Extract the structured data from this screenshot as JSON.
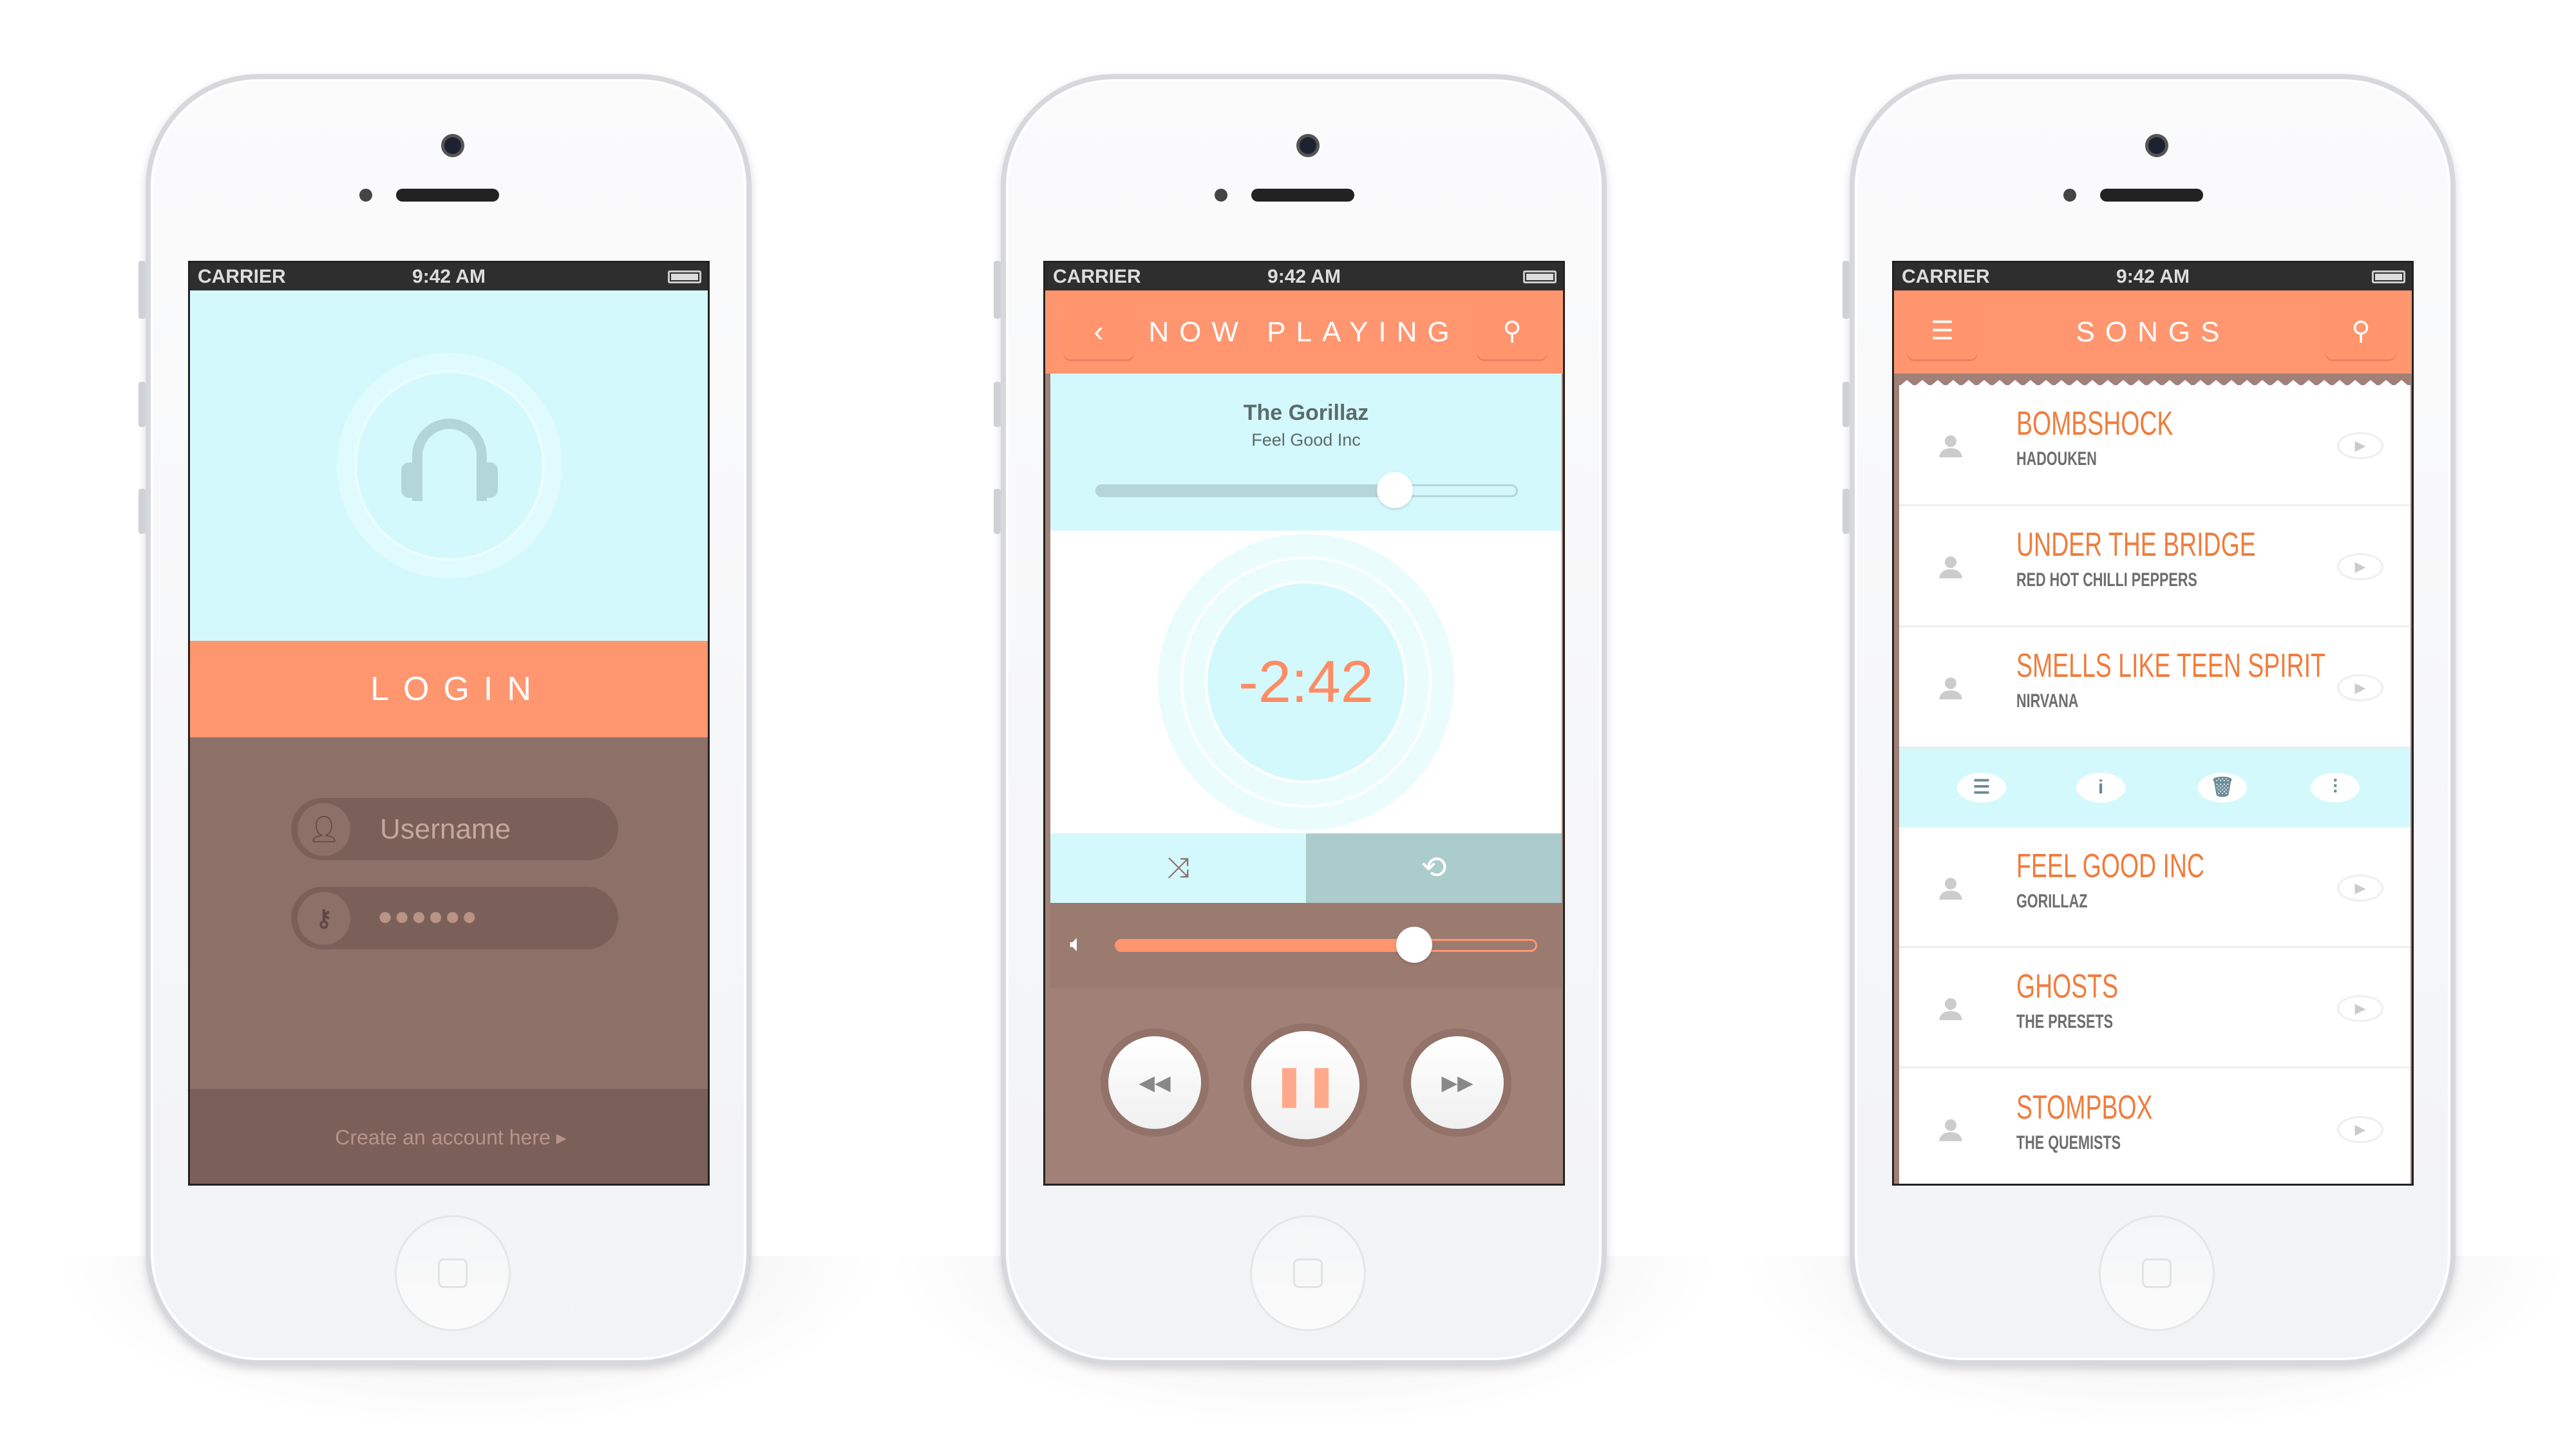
{
  "status": {
    "carrier": "CARRIER",
    "time": "9:42 AM"
  },
  "login": {
    "title": "LOGIN",
    "username_placeholder": "Username",
    "password_mask": "●●●●●●",
    "create_account": "Create an account here ▸"
  },
  "now_playing": {
    "title": "NOW PLAYING",
    "artist": "The Gorillaz",
    "track": "Feel Good Inc",
    "remaining": "-2:42",
    "progress": 0.71,
    "volume": 0.71
  },
  "songs": {
    "title": "SONGS",
    "items": [
      {
        "title": "BOMBSHOCK",
        "artist": "HADOUKEN"
      },
      {
        "title": "UNDER THE BRIDGE",
        "artist": "RED HOT CHILLI PEPPERS"
      },
      {
        "title": "SMELLS LIKE TEEN SPIRIT",
        "artist": "NIRVANA"
      },
      {
        "title": "FEEL GOOD INC",
        "artist": "GORILLAZ"
      },
      {
        "title": "GHOSTS",
        "artist": "THE PRESETS"
      },
      {
        "title": "STOMPBOX",
        "artist": "THE QUEMISTS"
      }
    ],
    "actions": [
      "list-icon",
      "info-icon",
      "trash-icon",
      "equalizer-icon"
    ]
  },
  "colors": {
    "accent": "#ff9670",
    "cyan": "#d4f9fc",
    "brown": "#8d7068",
    "song_title": "#f07c3c"
  }
}
